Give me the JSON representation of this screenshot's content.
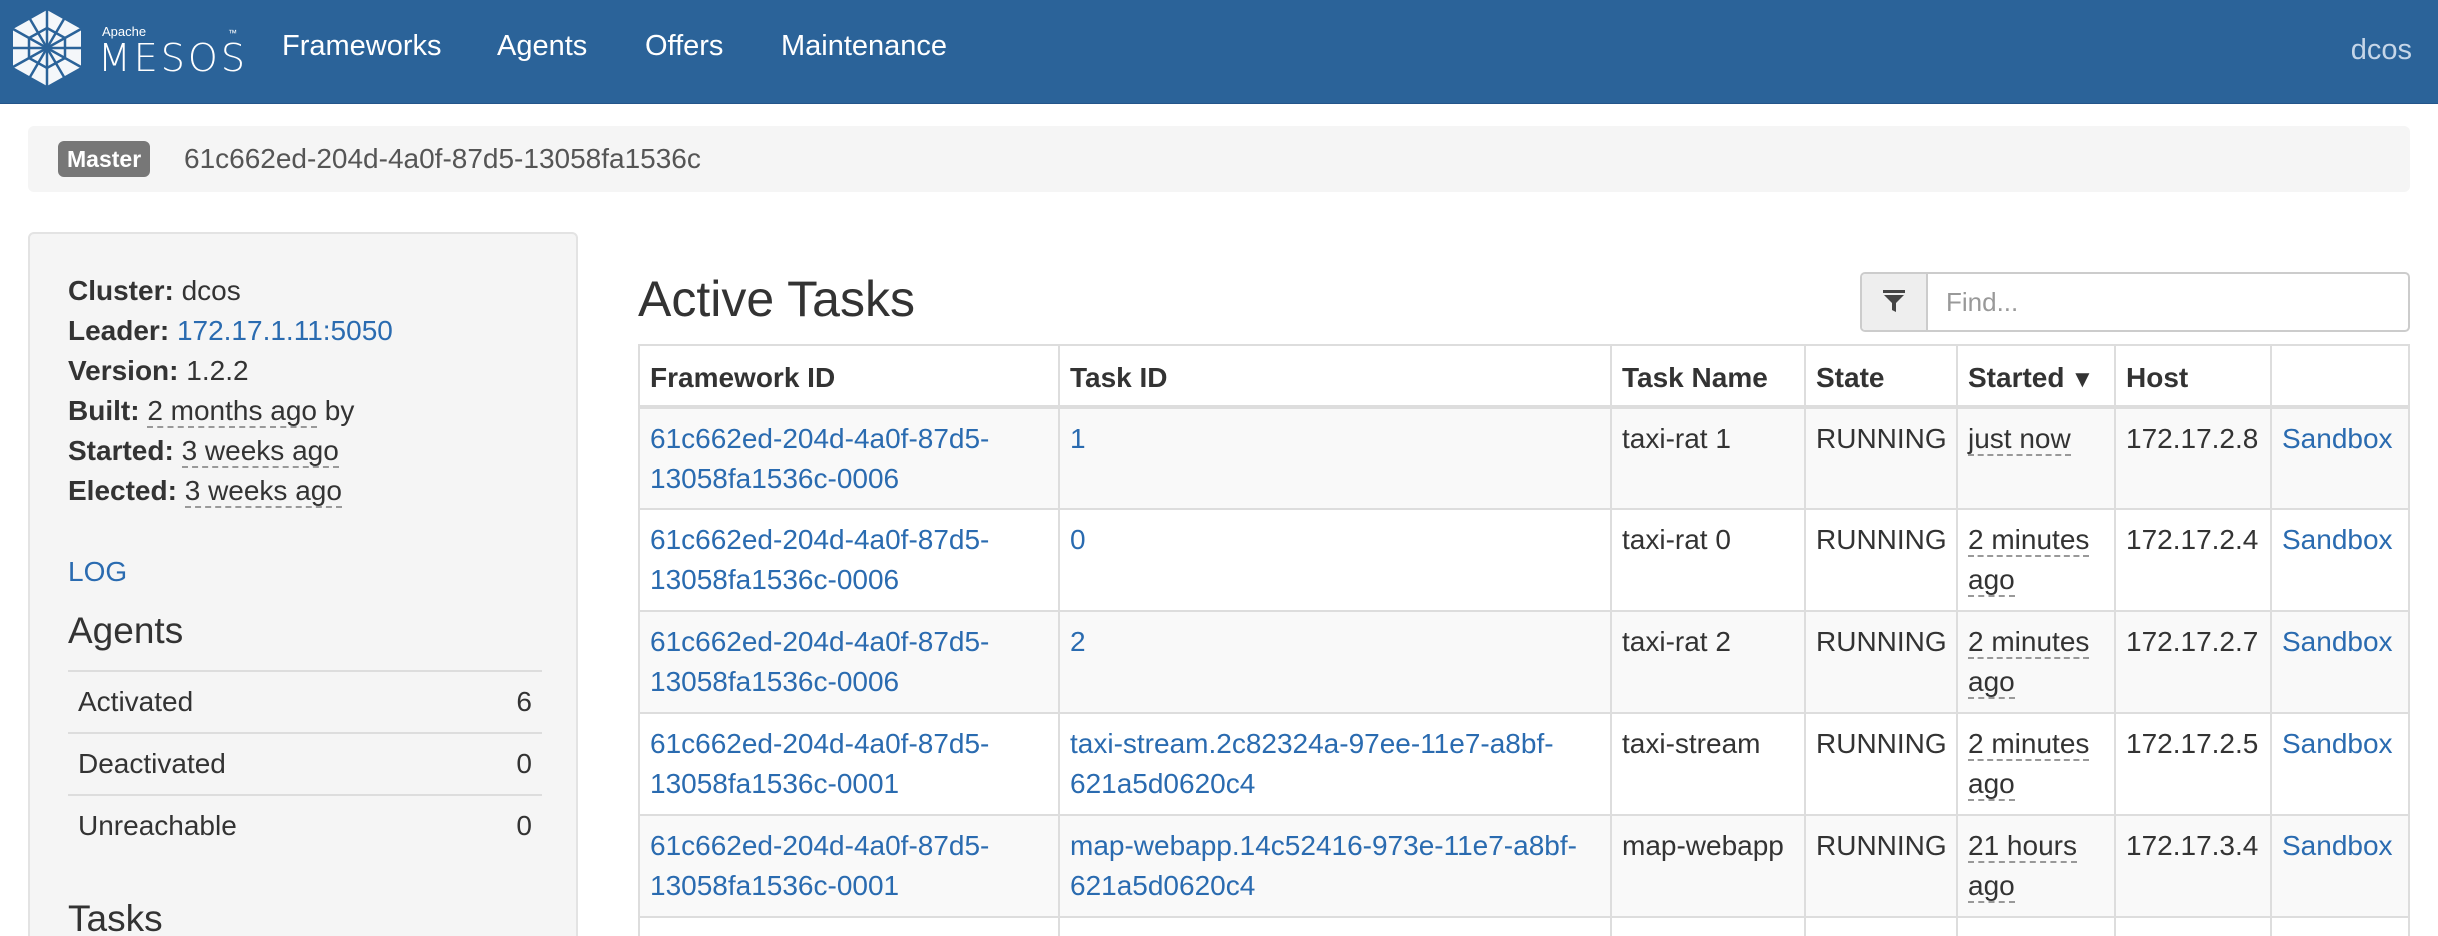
{
  "brand": {
    "apache": "Apache",
    "name": "MESOS",
    "tm": "™"
  },
  "nav": {
    "items": [
      "Frameworks",
      "Agents",
      "Offers",
      "Maintenance"
    ],
    "user": "dcos"
  },
  "breadcrumb": {
    "label": "Master",
    "id": "61c662ed-204d-4a0f-87d5-13058fa1536c"
  },
  "sidebar": {
    "cluster_label": "Cluster:",
    "cluster": "dcos",
    "leader_label": "Leader:",
    "leader": "172.17.1.11:5050",
    "version_label": "Version:",
    "version": "1.2.2",
    "built_label": "Built:",
    "built": "2 months ago",
    "built_suffix": "by",
    "started_label": "Started:",
    "started": "3 weeks ago",
    "elected_label": "Elected:",
    "elected": "3 weeks ago",
    "log": "LOG",
    "agents_title": "Agents",
    "agents": [
      {
        "label": "Activated",
        "value": "6"
      },
      {
        "label": "Deactivated",
        "value": "0"
      },
      {
        "label": "Unreachable",
        "value": "0"
      }
    ],
    "tasks_title": "Tasks"
  },
  "main": {
    "title": "Active Tasks",
    "search_placeholder": "Find...",
    "columns": [
      "Framework ID",
      "Task ID",
      "Task Name",
      "State",
      "Started",
      "Host",
      ""
    ],
    "sort_arrow": "▼",
    "rows": [
      {
        "fw1": "61c662ed-204d-4a0f-87d5-",
        "fw2": "13058fa1536c-0006",
        "tid1": "1",
        "tid2": "",
        "name": "taxi-rat 1",
        "state": "RUNNING",
        "st1": "just now",
        "st2": "",
        "host": "172.17.2.8",
        "sandbox": "Sandbox"
      },
      {
        "fw1": "61c662ed-204d-4a0f-87d5-",
        "fw2": "13058fa1536c-0006",
        "tid1": "0",
        "tid2": "",
        "name": "taxi-rat 0",
        "state": "RUNNING",
        "st1": "2 minutes",
        "st2": "ago",
        "host": "172.17.2.4",
        "sandbox": "Sandbox"
      },
      {
        "fw1": "61c662ed-204d-4a0f-87d5-",
        "fw2": "13058fa1536c-0006",
        "tid1": "2",
        "tid2": "",
        "name": "taxi-rat 2",
        "state": "RUNNING",
        "st1": "2 minutes",
        "st2": "ago",
        "host": "172.17.2.7",
        "sandbox": "Sandbox"
      },
      {
        "fw1": "61c662ed-204d-4a0f-87d5-",
        "fw2": "13058fa1536c-0001",
        "tid1": "taxi-stream.2c82324a-97ee-11e7-a8bf-",
        "tid2": "621a5d0620c4",
        "name": "taxi-stream",
        "state": "RUNNING",
        "st1": "2 minutes",
        "st2": "ago",
        "host": "172.17.2.5",
        "sandbox": "Sandbox"
      },
      {
        "fw1": "61c662ed-204d-4a0f-87d5-",
        "fw2": "13058fa1536c-0001",
        "tid1": "map-webapp.14c52416-973e-11e7-a8bf-",
        "tid2": "621a5d0620c4",
        "name": "map-webapp",
        "state": "RUNNING",
        "st1": "21 hours",
        "st2": "ago",
        "host": "172.17.3.4",
        "sandbox": "Sandbox"
      }
    ]
  }
}
